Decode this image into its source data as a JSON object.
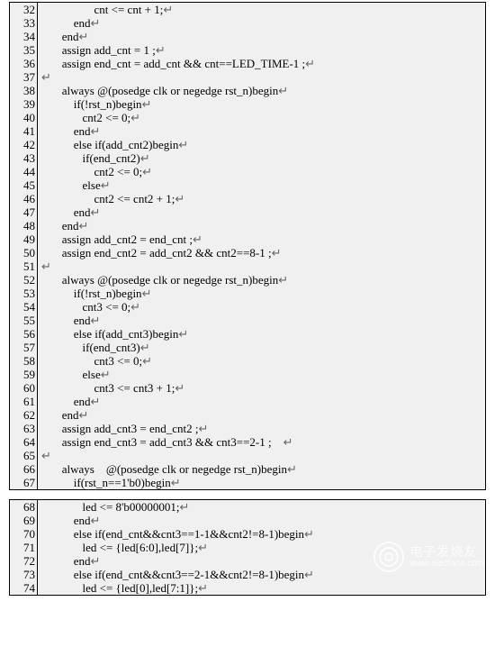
{
  "panels": [
    {
      "lines": [
        {
          "n": 32,
          "indent": 20,
          "code": "cnt <= cnt + 1;"
        },
        {
          "n": 33,
          "indent": 12,
          "code": "end"
        },
        {
          "n": 34,
          "indent": 8,
          "code": "end"
        },
        {
          "n": 35,
          "indent": 8,
          "code": "assign add_cnt = 1 ;"
        },
        {
          "n": 36,
          "indent": 8,
          "code": "assign end_cnt = add_cnt && cnt==LED_TIME-1 ;"
        },
        {
          "n": 37,
          "indent": 0,
          "code": ""
        },
        {
          "n": 38,
          "indent": 8,
          "code": "always @(posedge clk or negedge rst_n)begin"
        },
        {
          "n": 39,
          "indent": 12,
          "code": "if(!rst_n)begin"
        },
        {
          "n": 40,
          "indent": 16,
          "code": "cnt2 <= 0;"
        },
        {
          "n": 41,
          "indent": 12,
          "code": "end"
        },
        {
          "n": 42,
          "indent": 12,
          "code": "else if(add_cnt2)begin"
        },
        {
          "n": 43,
          "indent": 16,
          "code": "if(end_cnt2)"
        },
        {
          "n": 44,
          "indent": 20,
          "code": "cnt2 <= 0;"
        },
        {
          "n": 45,
          "indent": 16,
          "code": "else"
        },
        {
          "n": 46,
          "indent": 20,
          "code": "cnt2 <= cnt2 + 1;"
        },
        {
          "n": 47,
          "indent": 12,
          "code": "end"
        },
        {
          "n": 48,
          "indent": 8,
          "code": "end"
        },
        {
          "n": 49,
          "indent": 8,
          "code": "assign add_cnt2 = end_cnt ;"
        },
        {
          "n": 50,
          "indent": 8,
          "code": "assign end_cnt2 = add_cnt2 && cnt2==8-1 ;"
        },
        {
          "n": 51,
          "indent": 0,
          "code": ""
        },
        {
          "n": 52,
          "indent": 8,
          "code": "always @(posedge clk or negedge rst_n)begin"
        },
        {
          "n": 53,
          "indent": 12,
          "code": "if(!rst_n)begin"
        },
        {
          "n": 54,
          "indent": 16,
          "code": "cnt3 <= 0;"
        },
        {
          "n": 55,
          "indent": 12,
          "code": "end"
        },
        {
          "n": 56,
          "indent": 12,
          "code": "else if(add_cnt3)begin"
        },
        {
          "n": 57,
          "indent": 16,
          "code": "if(end_cnt3)"
        },
        {
          "n": 58,
          "indent": 20,
          "code": "cnt3 <= 0;"
        },
        {
          "n": 59,
          "indent": 16,
          "code": "else"
        },
        {
          "n": 60,
          "indent": 20,
          "code": "cnt3 <= cnt3 + 1;"
        },
        {
          "n": 61,
          "indent": 12,
          "code": "end"
        },
        {
          "n": 62,
          "indent": 8,
          "code": "end"
        },
        {
          "n": 63,
          "indent": 8,
          "code": "assign add_cnt3 = end_cnt2 ;"
        },
        {
          "n": 64,
          "indent": 8,
          "code": "assign end_cnt3 = add_cnt3 && cnt3==2-1 ;    "
        },
        {
          "n": 65,
          "indent": 0,
          "code": ""
        },
        {
          "n": 66,
          "indent": 8,
          "code": "always    @(posedge clk or negedge rst_n)begin"
        },
        {
          "n": 67,
          "indent": 12,
          "code": "if(rst_n==1'b0)begin"
        }
      ]
    },
    {
      "lines": [
        {
          "n": 68,
          "indent": 16,
          "code": "led <= 8'b00000001;"
        },
        {
          "n": 69,
          "indent": 12,
          "code": "end"
        },
        {
          "n": 70,
          "indent": 12,
          "code": "else if(end_cnt&&cnt3==1-1&&cnt2!=8-1)begin"
        },
        {
          "n": 71,
          "indent": 16,
          "code": "led <= {led[6:0],led[7]};"
        },
        {
          "n": 72,
          "indent": 12,
          "code": "end"
        },
        {
          "n": 73,
          "indent": 12,
          "code": "else if(end_cnt&&cnt3==2-1&&cnt2!=8-1)begin"
        },
        {
          "n": 74,
          "indent": 16,
          "code": "led <= {led[0],led[7:1]};"
        }
      ]
    }
  ],
  "return_glyph": "↵",
  "watermark": {
    "cn": "电子发烧友",
    "url": "www.elecfans.com"
  }
}
